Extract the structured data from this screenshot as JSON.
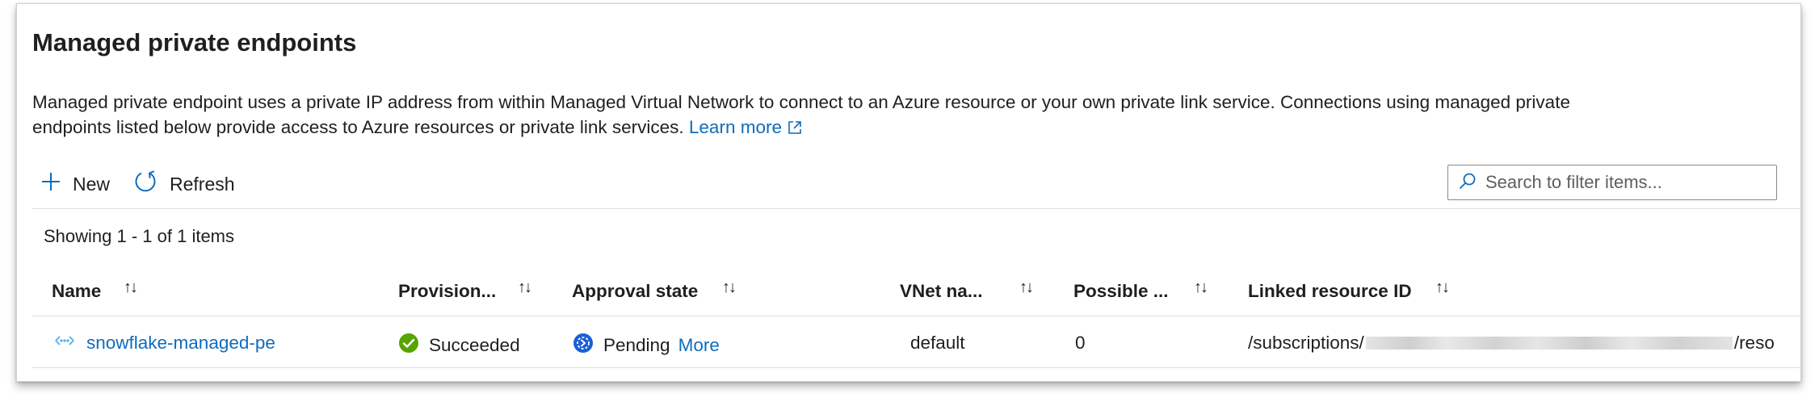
{
  "page": {
    "title": "Managed private endpoints",
    "description": "Managed private endpoint uses a private IP address from within Managed Virtual Network to connect to an Azure resource or your own private link service. Connections using managed private endpoints listed below provide access to Azure resources or private link services.",
    "learn_more": "Learn more"
  },
  "toolbar": {
    "new_label": "New",
    "refresh_label": "Refresh"
  },
  "search": {
    "placeholder": "Search to filter items..."
  },
  "grid": {
    "showing": "Showing 1 - 1 of 1 items",
    "columns": [
      {
        "label": "Name"
      },
      {
        "label": "Provision..."
      },
      {
        "label": "Approval state"
      },
      {
        "label": "VNet na..."
      },
      {
        "label": "Possible ..."
      },
      {
        "label": "Linked resource ID"
      }
    ],
    "rows": [
      {
        "name": "snowflake-managed-pe",
        "provisioning": "Succeeded",
        "approval": "Pending",
        "approval_more": "More",
        "vnet": "default",
        "possible": "0",
        "resource_prefix": "/subscriptions/",
        "resource_suffix": "/reso"
      }
    ]
  },
  "icons": {
    "new": "plus-icon",
    "refresh": "refresh-icon",
    "search": "search-icon",
    "external": "external-link-icon",
    "endpoint": "private-endpoint-icon",
    "succeeded": "success-check-icon",
    "pending": "pending-icon",
    "sort": "sort-arrows-icon"
  },
  "colors": {
    "link": "#0f6cbd",
    "success": "#57a300",
    "pending": "#0f6cbd",
    "border": "#e1dfdd"
  }
}
